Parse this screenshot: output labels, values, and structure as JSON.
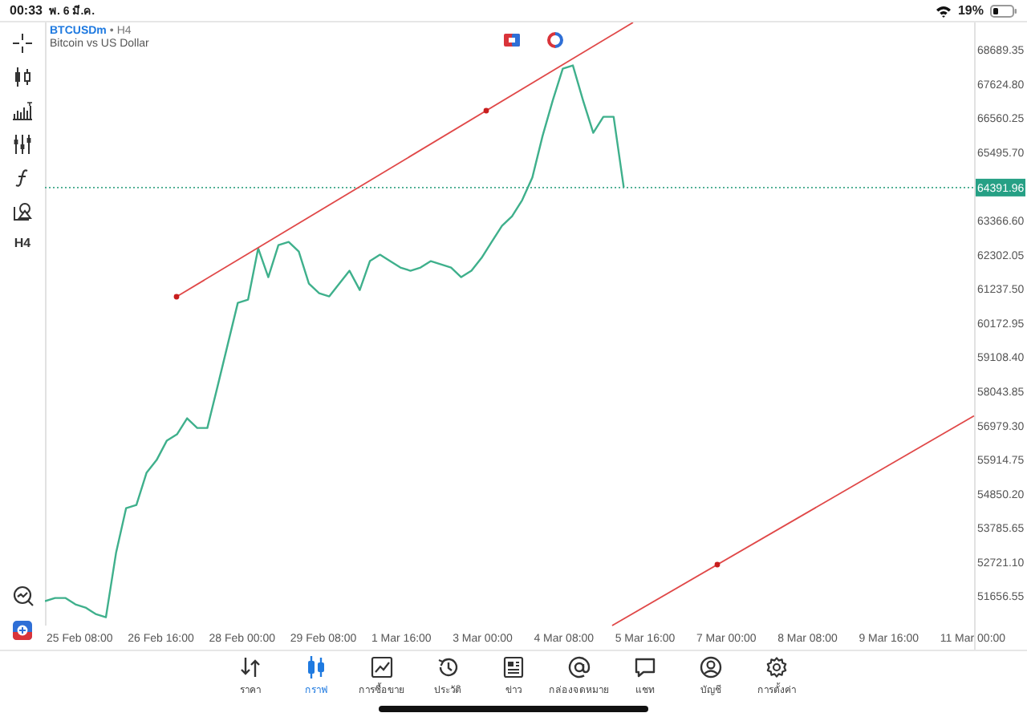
{
  "status_bar": {
    "time": "00:33",
    "date": "พ. 6 มี.ค.",
    "battery": "19%"
  },
  "toolbar": {
    "timeframe": "H4"
  },
  "chart": {
    "symbol": "BTCUSDm",
    "separator": "•",
    "timeframe": "H4",
    "description": "Bitcoin vs US Dollar",
    "current_price": "64391.96",
    "chart_data": {
      "type": "line",
      "categories": [
        null,
        null,
        null,
        "25 Feb 08:00",
        null,
        null,
        null,
        null,
        null,
        null,
        null,
        "26 Feb 16:00",
        null,
        null,
        null,
        null,
        null,
        null,
        null,
        "28 Feb 00:00",
        null,
        null,
        null,
        null,
        null,
        null,
        null,
        "29 Feb 08:00",
        null,
        null,
        null,
        null,
        null,
        null,
        null,
        "1 Mar 16:00",
        null,
        null,
        null,
        null,
        null,
        null,
        null,
        "3 Mar 00:00",
        null,
        null,
        null,
        null,
        null,
        null,
        null,
        "4 Mar 08:00",
        null,
        null,
        null,
        null,
        null,
        null,
        null,
        "5 Mar 16:00",
        null,
        null,
        null,
        null,
        null,
        null,
        null,
        "7 Mar 00:00",
        null,
        null,
        null,
        null,
        null,
        null,
        null,
        "8 Mar 08:00",
        null,
        null,
        null,
        null,
        null,
        null,
        null,
        "9 Mar 16:00",
        null,
        null,
        null,
        null,
        null,
        null,
        null,
        "11 Mar 00:00"
      ],
      "series": [
        {
          "color": "#3fb08c",
          "values": [
            51500,
            51600,
            51600,
            51400,
            51300,
            51100,
            51000,
            53000,
            54400,
            54500,
            55500,
            55900,
            56500,
            56700,
            57200,
            56900,
            56900,
            58200,
            59500,
            60800,
            60900,
            62500,
            61600,
            62600,
            62700,
            62400,
            61400,
            61100,
            61000,
            61400,
            61800,
            61200,
            62100,
            62300,
            62100,
            61900,
            61800,
            61900,
            62100,
            62000,
            61900,
            61600,
            61800,
            62200,
            62700,
            63200,
            63500,
            64000,
            64700,
            66000,
            67100,
            68100,
            68200,
            67100,
            66100,
            66600,
            66600,
            64400,
            null,
            null,
            null,
            null,
            null,
            null,
            null,
            null,
            null,
            null,
            null,
            null,
            null,
            null,
            null,
            null,
            null,
            null,
            null,
            null,
            null,
            null,
            null,
            null,
            null,
            null,
            null,
            null,
            null,
            null,
            null,
            null,
            null,
            null
          ]
        }
      ],
      "ylim": [
        50739,
        69539
      ],
      "yticks": [
        {
          "value": 68689.35,
          "label": "68689.35"
        },
        {
          "value": 67624.8,
          "label": "67624.80"
        },
        {
          "value": 66560.25,
          "label": "66560.25"
        },
        {
          "value": 65495.7,
          "label": "65495.70"
        },
        {
          "value": 63366.6,
          "label": "63366.60"
        },
        {
          "value": 62302.05,
          "label": "62302.05"
        },
        {
          "value": 61237.5,
          "label": "61237.50"
        },
        {
          "value": 60172.95,
          "label": "60172.95"
        },
        {
          "value": 59108.4,
          "label": "59108.40"
        },
        {
          "value": 58043.85,
          "label": "58043.85"
        },
        {
          "value": 56979.3,
          "label": "56979.30"
        },
        {
          "value": 55914.75,
          "label": "55914.75"
        },
        {
          "value": 54850.2,
          "label": "54850.20"
        },
        {
          "value": 53785.65,
          "label": "53785.65"
        },
        {
          "value": 52721.1,
          "label": "52721.10"
        },
        {
          "value": 51656.55,
          "label": "51656.55"
        }
      ]
    }
  },
  "tabs": [
    {
      "label": "ราคา",
      "selected": false
    },
    {
      "label": "กราฟ",
      "selected": true
    },
    {
      "label": "การซื้อขาย",
      "selected": false
    },
    {
      "label": "ประวัติ",
      "selected": false
    },
    {
      "label": "ข่าว",
      "selected": false
    },
    {
      "label": "กล่องจดหมาย",
      "selected": false
    },
    {
      "label": "แชท",
      "selected": false
    },
    {
      "label": "บัญชี",
      "selected": false
    },
    {
      "label": "การตั้งค่า",
      "selected": false
    }
  ]
}
